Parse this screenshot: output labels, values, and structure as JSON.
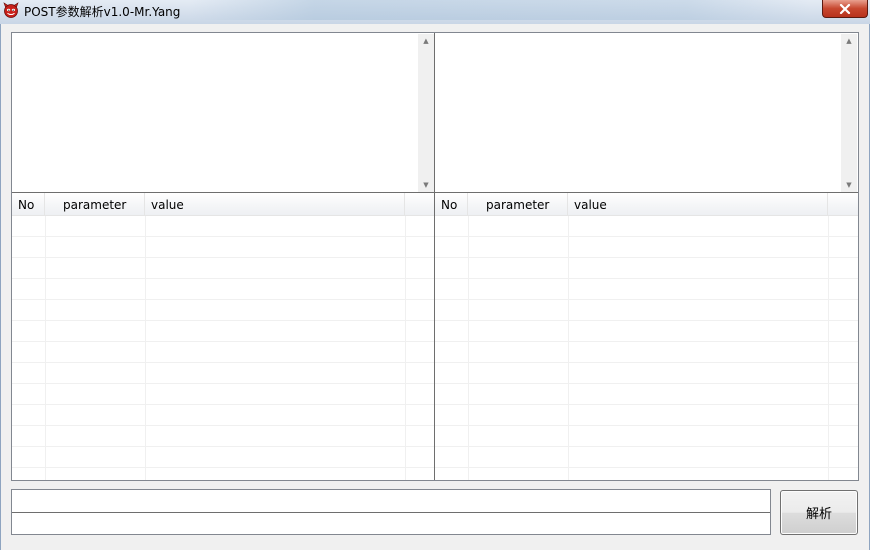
{
  "window": {
    "title": "POST参数解析v1.0-Mr.Yang",
    "close_glyph": "✕"
  },
  "left_panel": {
    "input_text": "",
    "table": {
      "columns": [
        "No",
        "parameter",
        "value",
        ""
      ],
      "rows": []
    }
  },
  "right_panel": {
    "input_text": "",
    "table": {
      "columns": [
        "No",
        "parameter",
        "value",
        ""
      ],
      "rows": []
    }
  },
  "bottom": {
    "output_line_1": "",
    "output_line_2": "",
    "parse_button_label": "解析"
  },
  "colors": {
    "close_button": "#c7472f",
    "titlebar": "#c9d6e6"
  }
}
